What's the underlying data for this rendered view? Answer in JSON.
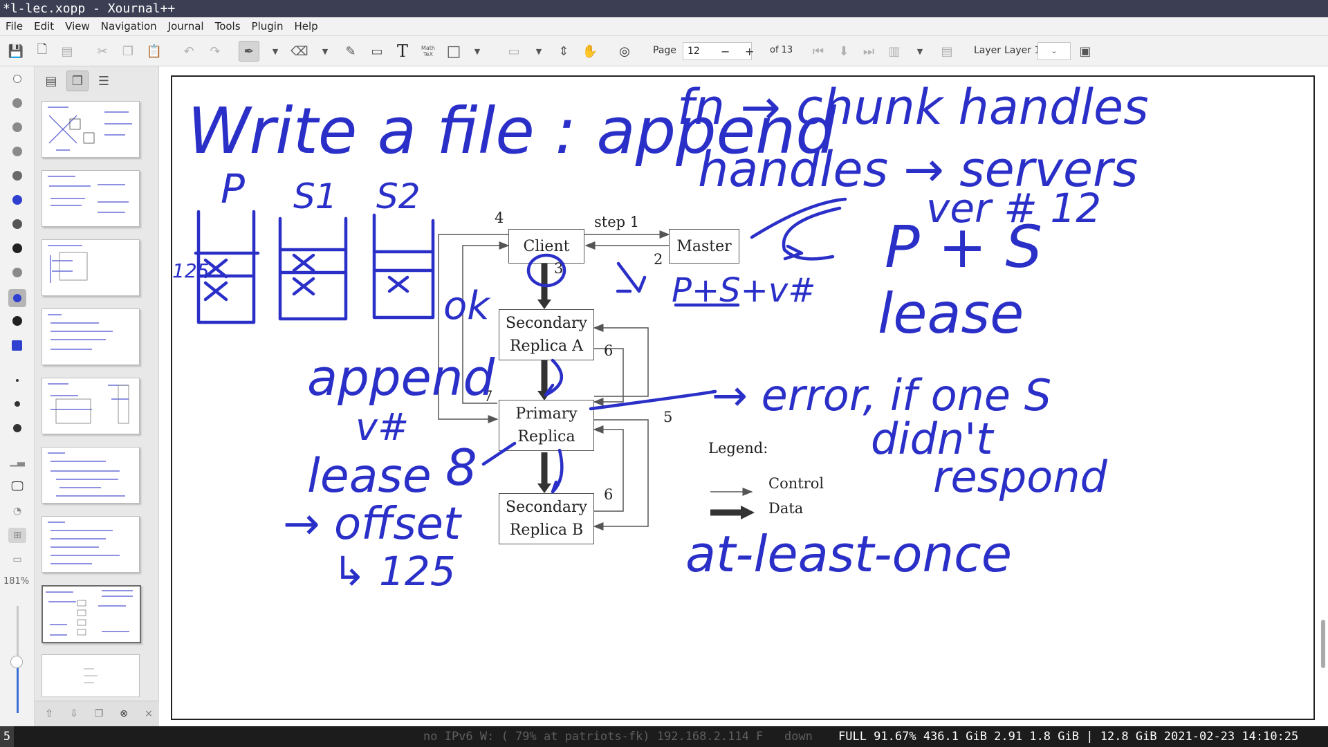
{
  "window": {
    "title": "*l-lec.xopp - Xournal++"
  },
  "menu": [
    "File",
    "Edit",
    "View",
    "Navigation",
    "Journal",
    "Tools",
    "Plugin",
    "Help"
  ],
  "toolbar": {
    "page_label": "Page",
    "page_value": "12",
    "minus": "−",
    "plus": "+",
    "of_pages": "of 13",
    "layer_label": "Layer",
    "layer_value": "Layer 1",
    "math_tex": "Math TeX",
    "text_tool": "T"
  },
  "toolstrip": {
    "zoom": "181%"
  },
  "figure": {
    "client": "Client",
    "master": "Master",
    "secondary_a": [
      "Secondary",
      "Replica A"
    ],
    "primary": [
      "Primary",
      "Replica"
    ],
    "secondary_b": [
      "Secondary",
      "Replica B"
    ],
    "step1": "step 1",
    "n2": "2",
    "n3": "3",
    "n4": "4",
    "n5": "5",
    "n6a": "6",
    "n6b": "6",
    "n7": "7",
    "legend": "Legend:",
    "control": "Control",
    "data": "Data"
  },
  "ink": {
    "title": "Write a file : append",
    "top_right_1": "fn → chunk handles",
    "top_right_2": "handles → servers",
    "ver": "ver # 12",
    "ps": "P + S",
    "lease_right": "lease",
    "p": "P",
    "s1": "S1",
    "s2": "S2",
    "num125": "125",
    "psv": "P+S+v#",
    "ok": "ok",
    "append": "append",
    "vhash": "v#",
    "lease": "lease",
    "offset": "→ offset",
    "num125b": "↳ 125",
    "eight": "8",
    "error1": "→ error, if one S",
    "error2": "didn't",
    "error3": "respond",
    "at_least_once": "at-least-once"
  },
  "status": {
    "workspace": "5",
    "dim": "no IPv6 W: ( 79% at patriots-fk) 192.168.2.114 F   down",
    "main": "FULL 91.67% 436.1 GiB 2.91 1.8 GiB | 12.8 GiB 2021-02-23 14:10:25"
  },
  "colors": {
    "ink": "#2a2fc8",
    "titlebar": "#3c3f53",
    "selected_color": "#2f3fd0"
  }
}
